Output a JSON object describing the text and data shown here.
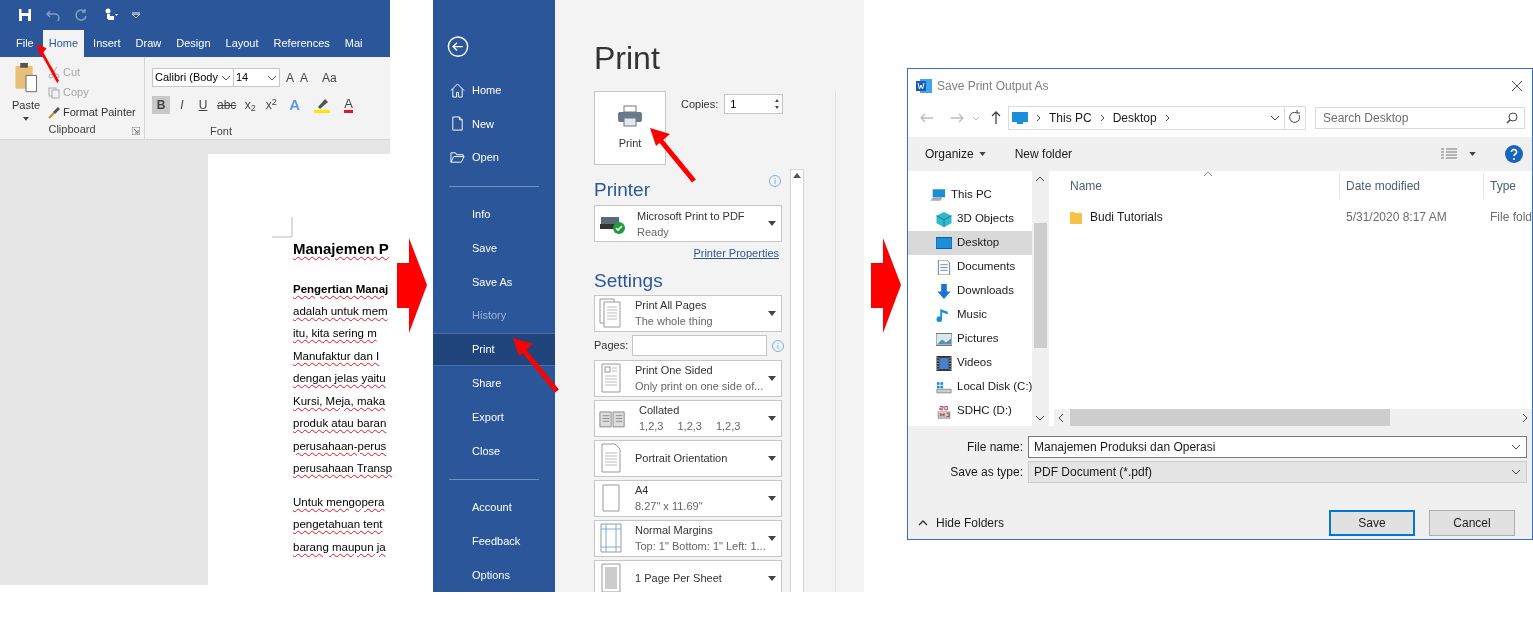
{
  "word": {
    "tabs": [
      {
        "label": "File",
        "selected": false
      },
      {
        "label": "Home",
        "selected": true
      },
      {
        "label": "Insert",
        "selected": false
      },
      {
        "label": "Draw",
        "selected": false
      },
      {
        "label": "Design",
        "selected": false
      },
      {
        "label": "Layout",
        "selected": false
      },
      {
        "label": "References",
        "selected": false
      },
      {
        "label": "Mai",
        "selected": false
      }
    ],
    "clipboard": {
      "paste": "Paste",
      "small_buttons": [
        {
          "label": "Cut",
          "disabled": true
        },
        {
          "label": "Copy",
          "disabled": true
        },
        {
          "label": "Format Painter",
          "disabled": false
        }
      ],
      "group_label": "Clipboard"
    },
    "font": {
      "name": "Calibri (Body",
      "size": "14",
      "size_tools": [
        "A",
        "A",
        "Aa"
      ],
      "format_buttons": [
        {
          "label": "B",
          "selected": true
        },
        {
          "label": "I",
          "selected": false
        },
        {
          "label": "U",
          "selected": false
        },
        {
          "label": "abc",
          "selected": false
        },
        {
          "label": "x$_{2}$",
          "selected": false
        },
        {
          "label": "x$^{2}$",
          "selected": false
        }
      ],
      "effects_button": "A",
      "font_color_button": "A",
      "group_label": "Font"
    },
    "document": {
      "heading": "Manajemen P",
      "lead": "Pengertian Manaj",
      "paragraphs": [
        [
          "adalah untuk mem",
          "itu, kita sering m",
          "Manufaktur dan I",
          "dengan jelas yaitu",
          "Kursi, Meja, maka",
          "produk atau baran",
          "perusahaan-perus",
          "perusahaan Transp"
        ],
        [
          "Untuk mengopera",
          "pengetahuan tent",
          "barang maupun ja"
        ]
      ]
    }
  },
  "backstage": {
    "nav_groups": [
      [
        {
          "label": "Home",
          "kind": "home",
          "selected": false,
          "disabled": false
        },
        {
          "label": "New",
          "kind": "new",
          "selected": false,
          "disabled": false
        },
        {
          "label": "Open",
          "kind": "open",
          "selected": false,
          "disabled": false
        }
      ],
      [
        {
          "label": "Info",
          "kind": "plain",
          "selected": false,
          "disabled": false
        },
        {
          "label": "Save",
          "kind": "plain",
          "selected": false,
          "disabled": false
        },
        {
          "label": "Save As",
          "kind": "plain",
          "selected": false,
          "disabled": false
        },
        {
          "label": "History",
          "kind": "plain",
          "selected": false,
          "disabled": true
        },
        {
          "label": "Print",
          "kind": "plain",
          "selected": true,
          "disabled": false
        },
        {
          "label": "Share",
          "kind": "plain",
          "selected": false,
          "disabled": false
        },
        {
          "label": "Export",
          "kind": "plain",
          "selected": false,
          "disabled": false
        },
        {
          "label": "Close",
          "kind": "plain",
          "selected": false,
          "disabled": false
        }
      ],
      [
        {
          "label": "Account",
          "kind": "plain",
          "selected": false,
          "disabled": false
        },
        {
          "label": "Feedback",
          "kind": "plain",
          "selected": false,
          "disabled": false
        },
        {
          "label": "Options",
          "kind": "plain",
          "selected": false,
          "disabled": false
        }
      ]
    ],
    "print": {
      "title": "Print",
      "print_button": "Print",
      "copies_label": "Copies:",
      "copies": "1",
      "printer_heading": "Printer",
      "printer": {
        "name": "Microsoft Print to PDF",
        "status": "Ready"
      },
      "printer_properties": "Printer Properties",
      "settings_heading": "Settings",
      "settings": [
        {
          "kind": "pages",
          "title": "Print All Pages",
          "subtitle": "The whole thing"
        },
        {
          "kind": "pages_field",
          "label": "Pages:"
        },
        {
          "kind": "sides",
          "title": "Print One Sided",
          "subtitle": "Only print on one side of..."
        },
        {
          "kind": "collate",
          "title": "Collated",
          "subtitle_parts": [
            "1,2,3",
            "1,2,3",
            "1,2,3"
          ]
        },
        {
          "kind": "orientation",
          "title": "Portrait Orientation"
        },
        {
          "kind": "paper",
          "title": "A4",
          "subtitle": "8.27\" x 11.69\""
        },
        {
          "kind": "margins",
          "title": "Normal Margins",
          "subtitle": "Top: 1\" Bottom: 1\" Left: 1..."
        },
        {
          "kind": "per_sheet",
          "title": "1 Page Per Sheet"
        }
      ]
    }
  },
  "dialog": {
    "title": "Save Print Output As",
    "breadcrumb": [
      "This PC",
      "Desktop"
    ],
    "search": {
      "placeholder": "Search Desktop"
    },
    "toolbar": {
      "organize": "Organize",
      "new_folder": "New folder"
    },
    "tree": [
      {
        "label": "This PC",
        "kind": "pc",
        "selected": false,
        "children": [
          {
            "label": "3D Objects",
            "kind": "objects",
            "selected": false
          },
          {
            "label": "Desktop",
            "kind": "desktop",
            "selected": true
          },
          {
            "label": "Documents",
            "kind": "documents",
            "selected": false
          },
          {
            "label": "Downloads",
            "kind": "downloads",
            "selected": false
          },
          {
            "label": "Music",
            "kind": "music",
            "selected": false
          },
          {
            "label": "Pictures",
            "kind": "pictures",
            "selected": false
          },
          {
            "label": "Videos",
            "kind": "videos",
            "selected": false
          },
          {
            "label": "Local Disk (C:)",
            "kind": "disk",
            "selected": false
          },
          {
            "label": "SDHC (D:)",
            "kind": "sd",
            "selected": false
          }
        ]
      }
    ],
    "columns": [
      "Name",
      "Date modified",
      "Type"
    ],
    "rows": [
      {
        "name": "Budi Tutorials",
        "date": "5/31/2020 8:17 AM",
        "type": "File fold"
      }
    ],
    "file_name_label": "File name:",
    "file_name": "Manajemen Produksi dan Operasi",
    "type_label": "Save as type:",
    "type": "PDF Document (*.pdf)",
    "hide_folders": "Hide Folders",
    "buttons": [
      "Save",
      "Cancel"
    ]
  }
}
